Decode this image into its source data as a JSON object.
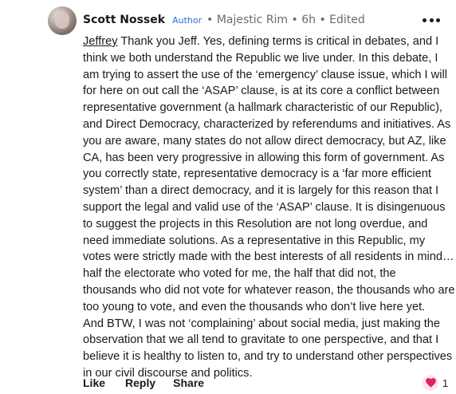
{
  "comment": {
    "author": "Scott Nossek",
    "badge": "Author",
    "meta": "• Majestic Rim • 6h • Edited",
    "mention": "Jeffrey",
    "lines": [
      " Thank you Jeff.  Yes, defining terms is critical in debates, and I",
      "think we both understand the Republic we live under.  In this debate, I",
      "am trying to assert the use of the ‘emergency’ clause issue, which I will",
      "for here on out call the ‘ASAP’ clause, is at its core a conflict between",
      "representative government (a hallmark characteristic of our Republic),",
      "and Direct Democracy, characterized by referendums and initiatives.  As",
      "you are aware, many states do not allow direct democracy, but AZ, like",
      "CA, has been very progressive in allowing this form of government.  As",
      "you correctly state, representative democracy is a ‘far more efficient",
      "system’ than a direct democracy, and it is largely for this reason that I",
      "support the legal and valid use of the ‘ASAP’ clause.  It is disingenuous",
      "to suggest the projects in this Resolution are not long overdue, and",
      "need immediate solutions.  As a representative in this Republic, my",
      "votes were strictly made with the best interests of all residents in mind…",
      "half the electorate who voted for me, the half that did not, the",
      "thousands who did not vote for whatever reason, the thousands who are",
      "too young to vote, and even the thousands who don’t live here yet.",
      "And BTW, I was not ‘complaining’ about social media, just making the",
      "observation that we all tend to gravitate to one perspective, and that I",
      "believe it is healthy to listen to, and try to understand other perspectives",
      "in our civil discourse and politics."
    ],
    "actions": {
      "like": "Like",
      "reply": "Reply",
      "share": "Share"
    },
    "reaction_count": "1",
    "reaction_icon": "heart-icon",
    "colors": {
      "badge": "#2f6bd6",
      "heart": "#e0245e",
      "meta": "#6b6b6b"
    }
  }
}
